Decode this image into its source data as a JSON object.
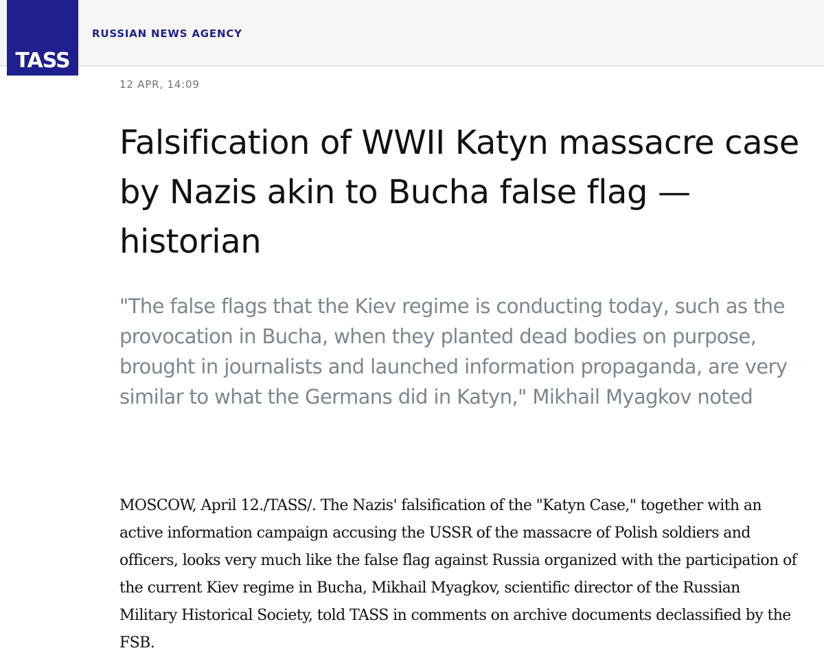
{
  "brand": {
    "logo_text": "TASS",
    "agency_name": "RUSSIAN NEWS AGENCY",
    "colors": {
      "brand_blue": "#1f1f8f",
      "header_bg": "#f6f6f6",
      "lead_gray": "#7d868d"
    }
  },
  "article": {
    "date": "12 APR, 14:09",
    "title": "Falsification of WWII Katyn massacre case by Nazis akin to Bucha false flag — historian",
    "lead": "\"The false flags that the Kiev regime is conducting today, such as the provocation in Bucha, when they planted dead bodies on purpose, brought in journalists and launched information propaganda, are very similar to what the Germans did in Katyn,\" Mikhail Myagkov noted",
    "body": "MOSCOW, April 12./TASS/. The Nazis' falsification of the \"Katyn Case,\" together with an active information campaign accusing the USSR of the massacre of Polish soldiers and officers, looks very much like the false flag against Russia organized with the participation of the current Kiev regime in Bucha, Mikhail Myagkov, scientific director of the Russian Military Historical Society, told TASS in comments on archive documents declassified by the FSB."
  }
}
